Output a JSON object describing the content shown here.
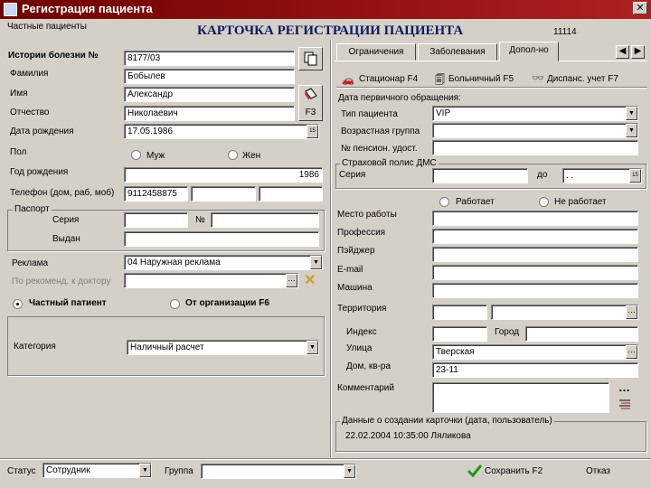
{
  "window": {
    "title": "Регистрация пациента",
    "close": "✕"
  },
  "subtitle": "Частные пациенты",
  "card": {
    "heading": "КАРТОЧКА РЕГИСТРАЦИИ ПАЦИЕНТА",
    "number": "11114"
  },
  "left": {
    "history_label": "Истории болезни №",
    "history_value": "8177/03",
    "surname_label": "Фамилия",
    "surname_value": "Бобылев",
    "name_label": "Имя",
    "name_value": "Александр",
    "patronymic_label": "Отчество",
    "patronymic_value": "Николаевич",
    "dob_label": "Дата рождения",
    "dob_value": "17.05.1986",
    "sex_label": "Пол",
    "sex_male": "Муж",
    "sex_female": "Жен",
    "birthyear_label": "Год рождения",
    "birthyear_value": "1986",
    "phone_label": "Телефон (дом, раб, моб)",
    "phone_home": "9112458875",
    "phone_work": "",
    "phone_mobile": "",
    "passport_label": "Паспорт",
    "series_label": "Серия",
    "series_value": "",
    "number_label": "№",
    "number_value": "",
    "issued_label": "Выдан",
    "issued_value": "",
    "ad_label": "Реклама",
    "ad_value": "04 Наружная реклама",
    "doctor_label": "По рекоменд. к доктору",
    "doctor_value": "",
    "f3_label": "F3",
    "private_label": "Частный патиент",
    "org_label": "От организации F6",
    "category_label": "Категория",
    "category_value": "Наличный расчет"
  },
  "tabs": [
    "Ограничения",
    "Заболевания",
    "Допол-но"
  ],
  "subtabs": {
    "inpatient": "Стационар F4",
    "sick_leave": "Больничный F5",
    "dispensary": "Диспанс. учет F7"
  },
  "right": {
    "first_visit_label": "Дата первичного обращения:",
    "patient_type_label": "Тип пациента",
    "patient_type_value": "VIP",
    "age_group_label": "Возрастная группа",
    "age_group_value": "",
    "pension_label": "№ пенсион. удост.",
    "pension_value": "",
    "insurance_label": "Страховой полис ДМС",
    "ins_series_label": "Серия",
    "ins_series_value": "",
    "ins_until_label": "до",
    "ins_until_value": ". .",
    "works_label": "Работает",
    "not_works_label": "Не работает",
    "workplace_label": "Место работы",
    "workplace_value": "",
    "profession_label": "Профессия",
    "profession_value": "",
    "pager_label": "Пэйджер",
    "pager_value": "",
    "email_label": "E-mail",
    "email_value": "",
    "car_label": "Машина",
    "car_value": "",
    "territory_label": "Территория",
    "territory_code": "",
    "territory_value": "",
    "index_label": "Индекс",
    "index_value": "",
    "city_label": "Город",
    "city_value": "",
    "street_label": "Улица",
    "street_value": "Тверская",
    "house_label": "Дом, кв-ра",
    "house_value": "23-11",
    "comment_label": "Комментарий",
    "comment_value": "",
    "created_label": "Данные о создании карточки (дата, пользователь)",
    "created_value": "22.02.2004 10:35:00  Ляликова"
  },
  "bottom": {
    "status_label": "Статус",
    "status_value": "Сотрудник",
    "group_label": "Группа",
    "group_value": "",
    "save_label": "Сохранить F2",
    "cancel_label": "Отказ"
  },
  "colors": {
    "titlebar": "#8b0000",
    "accent_check": "#1a9a1a"
  }
}
